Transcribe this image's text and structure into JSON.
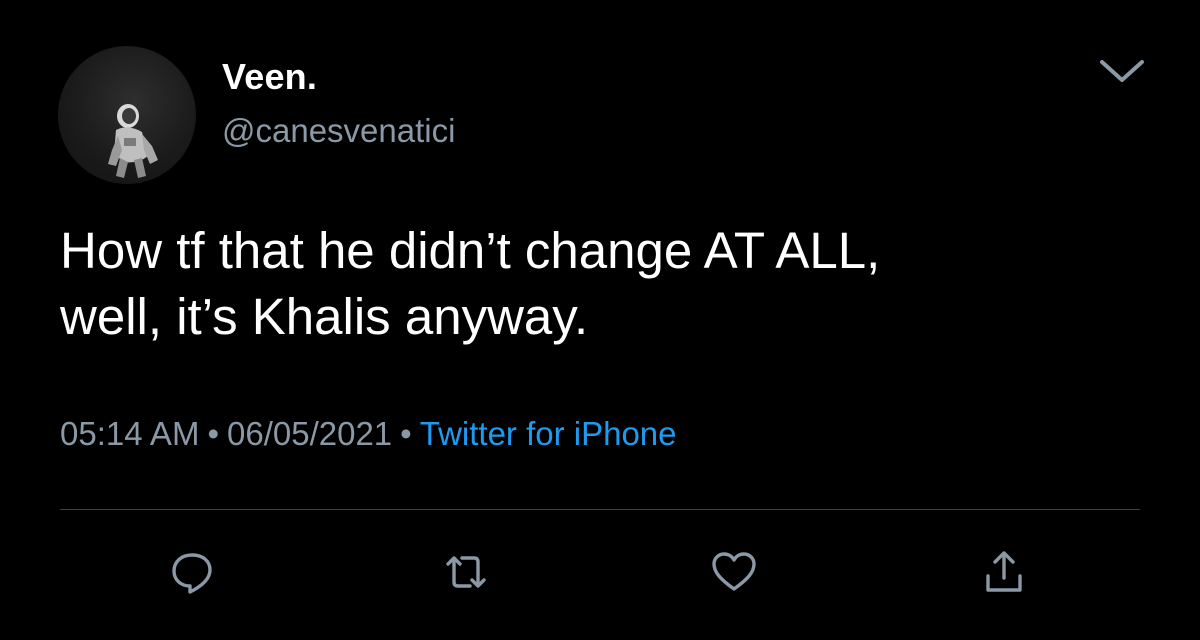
{
  "author": {
    "display_name": "Veen.",
    "handle": "@canesvenatici"
  },
  "tweet": {
    "text": "How tf that he didn’t change AT ALL,\nwell, it’s Khalis anyway.",
    "time": "05:14 AM",
    "date": "06/05/2021",
    "source": "Twitter for iPhone",
    "separator": "•"
  },
  "actions": {
    "reply_icon": "reply-icon",
    "retweet_icon": "retweet-icon",
    "like_icon": "heart-icon",
    "share_icon": "share-icon"
  },
  "colors": {
    "background": "#000000",
    "primary_text": "#ffffff",
    "secondary_text": "#8b98a5",
    "link": "#1d9bf0",
    "divider": "#3a3f44"
  }
}
